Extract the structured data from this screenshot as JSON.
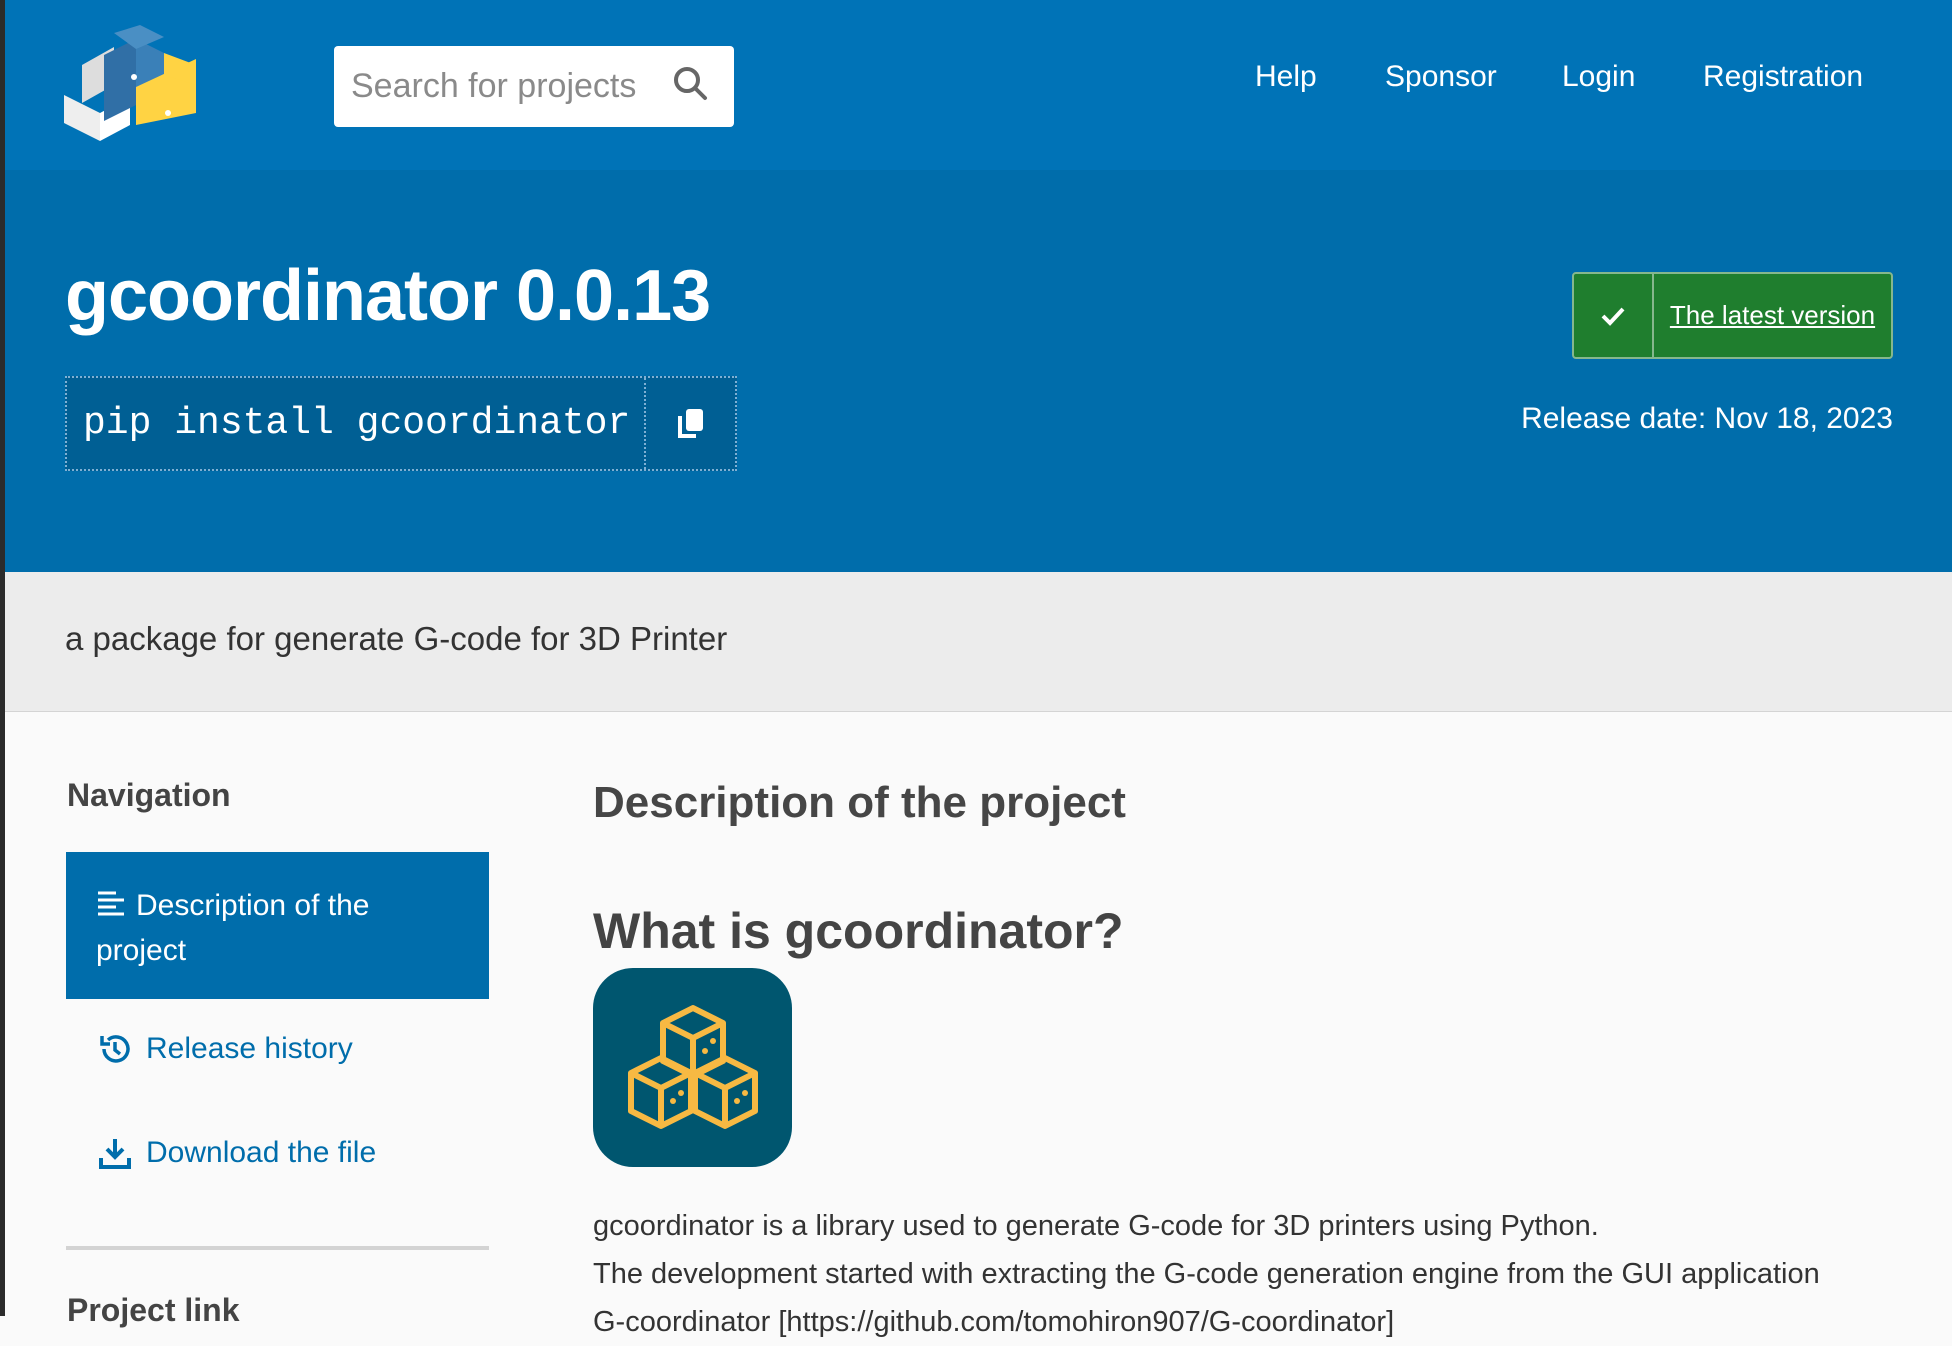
{
  "header": {
    "search_placeholder": "Search for projects",
    "nav": [
      "Help",
      "Sponsor",
      "Login",
      "Registration"
    ]
  },
  "hero": {
    "title": "gcoordinator 0.0.13",
    "pip_command": "pip install gcoordinator",
    "latest_label": "The latest version",
    "release_date": "Release date: Nov 18, 2023"
  },
  "tagline": "a package for generate G-code for 3D Printer",
  "sidebar": {
    "heading": "Navigation",
    "items": [
      "Description of the project",
      "Release history",
      "Download the file"
    ],
    "project_link_heading": "Project link"
  },
  "main": {
    "heading": "Description of the project",
    "subheading": "What is gcoordinator?",
    "paragraphs": [
      "gcoordinator is a library used to generate G-code for 3D printers using Python.",
      "The development started with extracting the G-code generation engine from the GUI application",
      "G-coordinator [https://github.com/tomohiron907/G-coordinator]"
    ]
  },
  "colors": {
    "header": "#0073b7",
    "hero": "#006dab",
    "latest": "#1f7e2e",
    "icon_bg": "#00566f",
    "icon_fg": "#f7b943"
  }
}
